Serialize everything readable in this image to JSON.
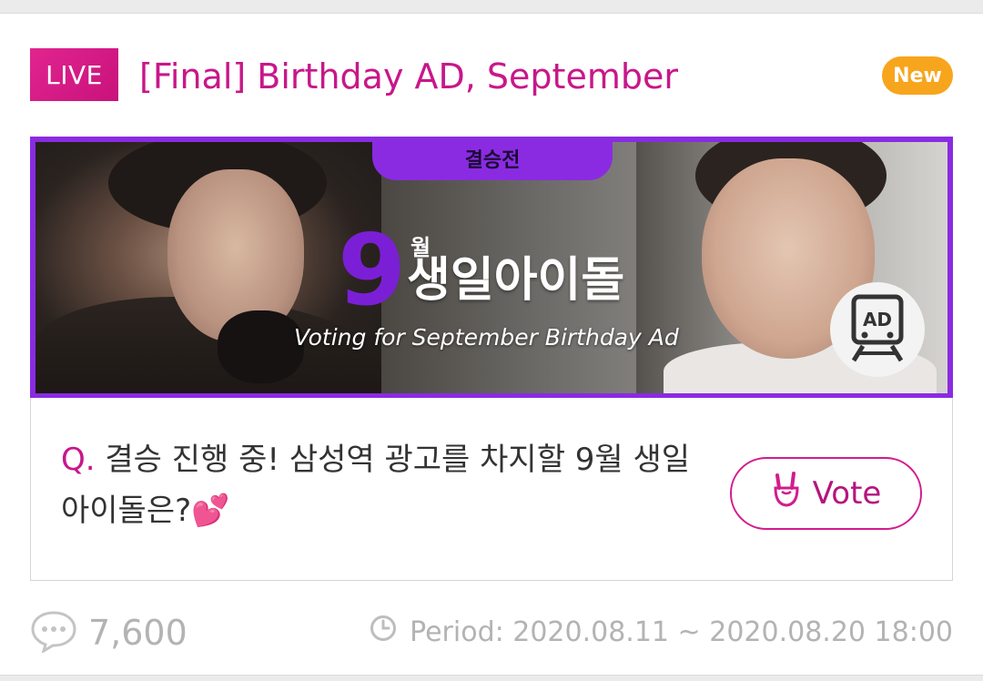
{
  "header": {
    "live_label": "LIVE",
    "title": "[Final] Birthday AD, September",
    "new_label": "New"
  },
  "banner": {
    "tab_label": "결승전",
    "big_number": "9",
    "month_word": "월",
    "heading": "생일아이돌",
    "subtitle": "Voting for September Birthday Ad",
    "ad_label": "AD",
    "frame_color": "#8a2be2"
  },
  "question": {
    "prefix": "Q.",
    "text": "결승 진행 중! 삼성역 광고를 차지할 9월 생일아이돌은?",
    "emoji": "💕"
  },
  "vote_button": {
    "icon": "rock-hand-icon",
    "label": "Vote"
  },
  "footer": {
    "comment_icon": "speech-bubble-icon",
    "comment_count": "7,600",
    "clock_icon": "clock-icon",
    "period_text": "Period: 2020.08.11 ~ 2020.08.20 18:00"
  },
  "colors": {
    "accent": "#c8178a",
    "new_badge": "#f7a51c",
    "muted": "#b3b3b3"
  }
}
